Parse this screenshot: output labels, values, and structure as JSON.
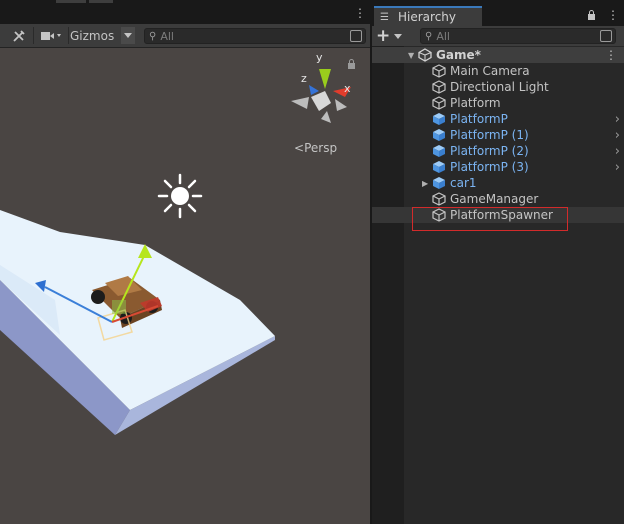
{
  "scene": {
    "gizmos_label": "Gizmos",
    "search_placeholder": "All",
    "persp_label": "Persp",
    "axes": {
      "x": "x",
      "y": "y",
      "z": "z"
    }
  },
  "hierarchy": {
    "tab_title": "Hierarchy",
    "search_placeholder": "All",
    "add_label": "+",
    "scene_name": "Game*",
    "items": [
      {
        "label": "Main Camera",
        "prefab": false
      },
      {
        "label": "Directional Light",
        "prefab": false
      },
      {
        "label": "Platform",
        "prefab": false
      },
      {
        "label": "PlatformP",
        "prefab": true
      },
      {
        "label": "PlatformP (1)",
        "prefab": true
      },
      {
        "label": "PlatformP (2)",
        "prefab": true
      },
      {
        "label": "PlatformP (3)",
        "prefab": true
      },
      {
        "label": "car1",
        "prefab": true
      },
      {
        "label": "GameManager",
        "prefab": false
      },
      {
        "label": "PlatformSpawner",
        "prefab": false
      }
    ]
  },
  "colors": {
    "prefab_text": "#7bb4f2",
    "highlight_box": "#d22b2b",
    "tab_accent": "#3a79bb"
  }
}
